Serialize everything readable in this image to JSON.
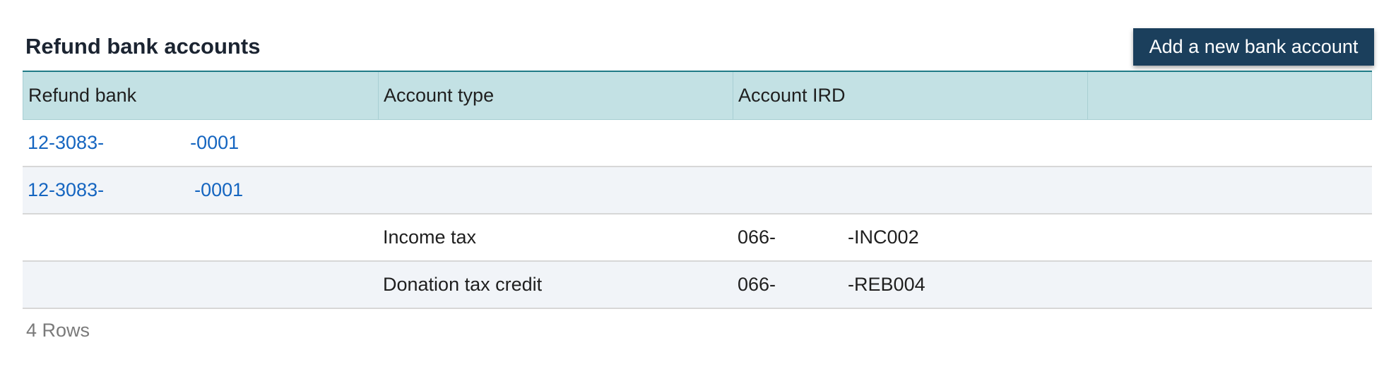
{
  "page": {
    "title": "Refund bank accounts",
    "add_button_label": "Add a new bank account"
  },
  "table": {
    "columns": [
      "Refund bank",
      "Account type",
      "Account IRD",
      ""
    ],
    "rows": [
      {
        "refund_bank_prefix": "12-3083-",
        "refund_bank_suffix": "-0001",
        "account_type": "",
        "account_ird_prefix": "",
        "account_ird_suffix": ""
      },
      {
        "refund_bank_prefix": "12-3083-",
        "refund_bank_suffix": "-0001",
        "account_type": "",
        "account_ird_prefix": "",
        "account_ird_suffix": ""
      },
      {
        "refund_bank_prefix": "",
        "refund_bank_suffix": "",
        "account_type": "Income tax",
        "account_ird_prefix": "066-",
        "account_ird_suffix": "-INC002"
      },
      {
        "refund_bank_prefix": "",
        "refund_bank_suffix": "",
        "account_type": "Donation tax credit",
        "account_ird_prefix": "066-",
        "account_ird_suffix": "-REB004"
      }
    ],
    "row_count_label": "4 Rows"
  },
  "colors": {
    "header_bg": "#c3e1e4",
    "button_bg": "#1b3f5c",
    "link": "#1565c0",
    "alt_row_bg": "#f1f4f8"
  }
}
